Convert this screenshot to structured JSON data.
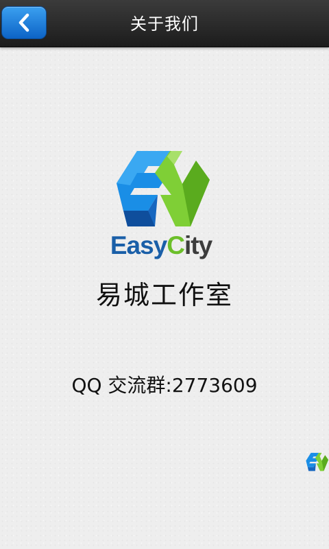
{
  "header": {
    "title": "关于我们",
    "back_icon": "chevron-left-icon"
  },
  "logo": {
    "text_easy": "Easy",
    "text_c": "C",
    "text_ity": "ity",
    "colors": {
      "blue": "#1a8ee6",
      "dark_blue": "#1a5fa8",
      "green": "#6cbf2a"
    }
  },
  "content": {
    "studio_name": "易城工作室",
    "qq_group": "QQ 交流群:2773609"
  },
  "colors": {
    "header_bg": "#2a2a2a",
    "back_button": "#1a7be0",
    "background": "#eeeeee"
  }
}
